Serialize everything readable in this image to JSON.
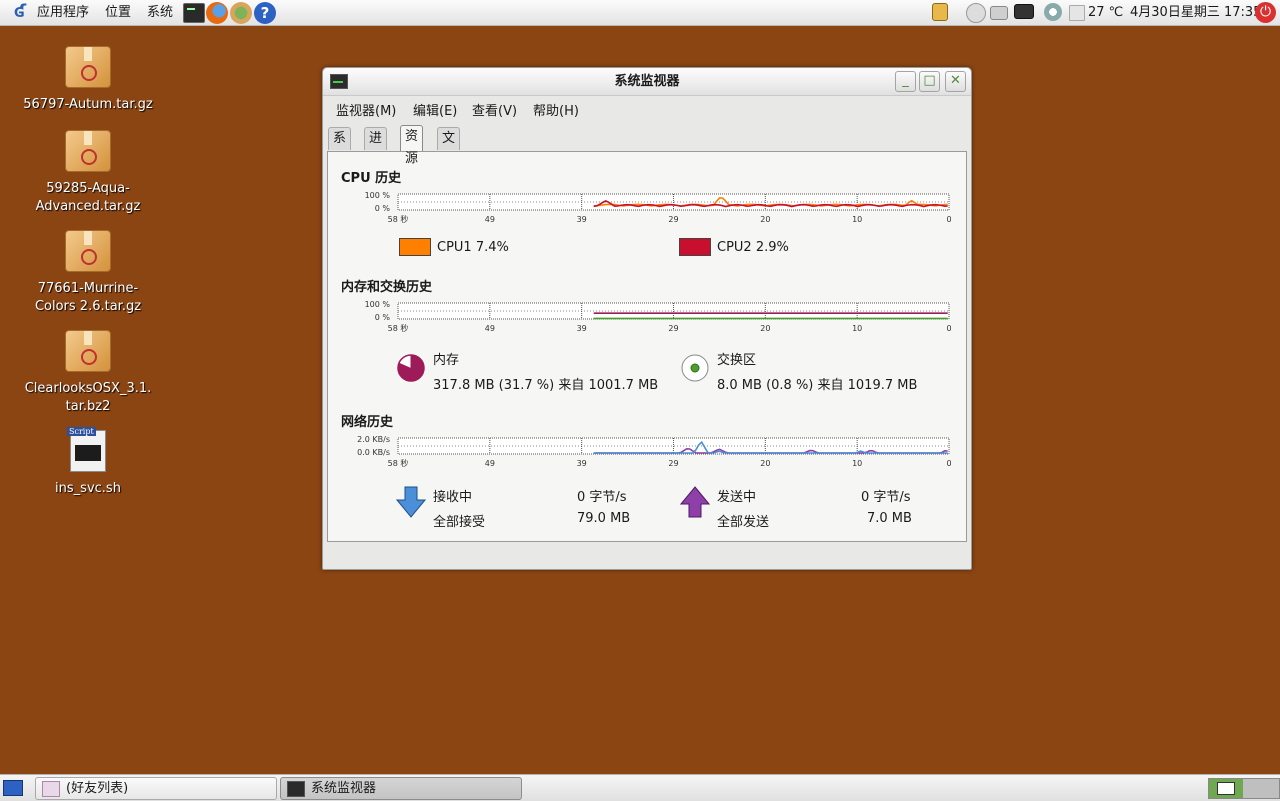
{
  "top_panel": {
    "menus": [
      "应用程序",
      "位置",
      "系统"
    ],
    "launchers": [
      "terminal-icon",
      "firefox-icon",
      "browser-icon",
      "help-icon"
    ],
    "temperature": "27 ℃",
    "clock": "4月30日星期三  17:35"
  },
  "desktop_icons": [
    {
      "label": "56797-Autum.tar.gz",
      "icon": "package-icon"
    },
    {
      "label": "59285-Aqua-Advanced.tar.gz",
      "icon": "package-icon"
    },
    {
      "label": "77661-Murrine-Colors 2.6.tar.gz",
      "icon": "package-icon"
    },
    {
      "label": "ClearlooksOSX_3.1.tar.bz2",
      "icon": "package-icon"
    },
    {
      "label": "ins_svc.sh",
      "icon": "script-icon",
      "tag": "Script"
    }
  ],
  "window": {
    "title": "系统监视器",
    "menu": [
      "监视器(M)",
      "编辑(E)",
      "查看(V)",
      "帮助(H)"
    ],
    "tabs": [
      "系统",
      "进程",
      "资源",
      "文件系统"
    ],
    "active_tab": "资源",
    "time_axis": [
      "58 秒",
      "49",
      "39",
      "29",
      "20",
      "10",
      "0"
    ],
    "cpu": {
      "title": "CPU 历史",
      "y_labels": [
        "100 %",
        "0 %"
      ],
      "legend": [
        {
          "label": "CPU1  7.4%",
          "color": "#ff7f00"
        },
        {
          "label": "CPU2  2.9%",
          "color": "#c8102e"
        }
      ]
    },
    "memory": {
      "title": "内存和交换历史",
      "y_labels": [
        "100 %",
        "0 %"
      ],
      "mem_label": "内存",
      "mem_value": "317.8 MB (31.7 %) 来自 1001.7 MB",
      "mem_color": "#9e1b5a",
      "mem_fraction": 0.317,
      "swap_label": "交换区",
      "swap_value": "8.0 MB (0.8 %) 来自 1019.7 MB",
      "swap_color": "#4aa02c",
      "swap_fraction": 0.008
    },
    "network": {
      "title": "网络历史",
      "y_labels": [
        "2.0 KB/s",
        "0.0 KB/s"
      ],
      "recv_label": "接收中",
      "recv_value": "0 字节/s",
      "recv_total_label": "全部接受",
      "recv_total": "79.0 MB",
      "send_label": "发送中",
      "send_value": "0 字节/s",
      "send_total_label": "全部发送",
      "send_total": "7.0 MB",
      "recv_color": "#4a8fd8",
      "send_color": "#8e3fa8"
    }
  },
  "taskbar": {
    "buttons": [
      "(好友列表)",
      "系统监视器"
    ],
    "active": "系统监视器"
  }
}
